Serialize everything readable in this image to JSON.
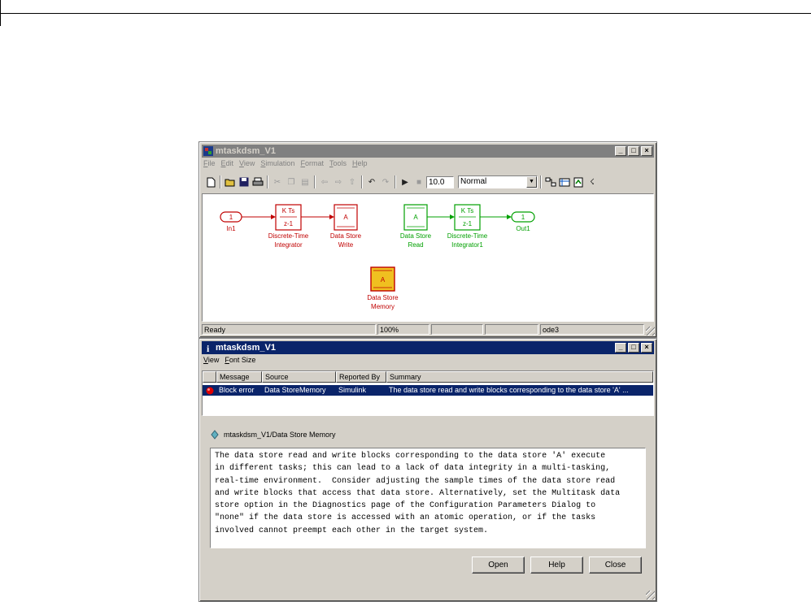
{
  "model_window": {
    "title": "mtaskdsm_V1",
    "menu": [
      "File",
      "Edit",
      "View",
      "Simulation",
      "Format",
      "Tools",
      "Help"
    ],
    "toolbar": {
      "stop_time": "10.0",
      "sim_mode": "Normal"
    },
    "diagram": {
      "in1": {
        "port": "1",
        "label": "In1"
      },
      "integrator": {
        "top": "K Ts",
        "bottom": "z-1",
        "label1": "Discrete-Time",
        "label2": "Integrator"
      },
      "dsw": {
        "text": "A",
        "label1": "Data Store",
        "label2": "Write"
      },
      "dsr": {
        "text": "A",
        "label1": "Data Store",
        "label2": "Read"
      },
      "integrator1": {
        "top": "K Ts",
        "bottom": "z-1",
        "label1": "Discrete-Time",
        "label2": "Integrator1"
      },
      "out1": {
        "port": "1",
        "label": "Out1"
      },
      "dsm": {
        "text": "A",
        "label1": "Data Store",
        "label2": "Memory"
      }
    },
    "status": {
      "state": "Ready",
      "zoom": "100%",
      "solver": "ode3"
    },
    "colors": {
      "red": "#c00000",
      "green": "#00a000",
      "memory_fill": "#f0c020"
    }
  },
  "diag_window": {
    "title": "mtaskdsm_V1",
    "menu": [
      "View",
      "Font Size"
    ],
    "columns": [
      "Message",
      "Source",
      "Reported By",
      "Summary"
    ],
    "rows": [
      {
        "message": "Block error",
        "source": "Data StoreMemory",
        "reported_by": "Simulink",
        "summary": "The data store read and write blocks corresponding to the data store 'A' ..."
      }
    ],
    "path": "mtaskdsm_V1/Data Store Memory",
    "message_lines": [
      "The data store read and write blocks corresponding to the data store 'A' execute",
      "in different tasks; this can lead to a lack of data integrity in a multi-tasking,",
      "real-time environment.  Consider adjusting the sample times of the data store read",
      "and write blocks that access that data store. Alternatively, set the Multitask data",
      "store option in the Diagnostics page of the Configuration Parameters Dialog to",
      "\"none\" if the data store is accessed with an atomic operation, or if the tasks",
      "involved cannot preempt each other in the target system."
    ],
    "buttons": {
      "open": "Open",
      "help": "Help",
      "close": "Close"
    }
  }
}
